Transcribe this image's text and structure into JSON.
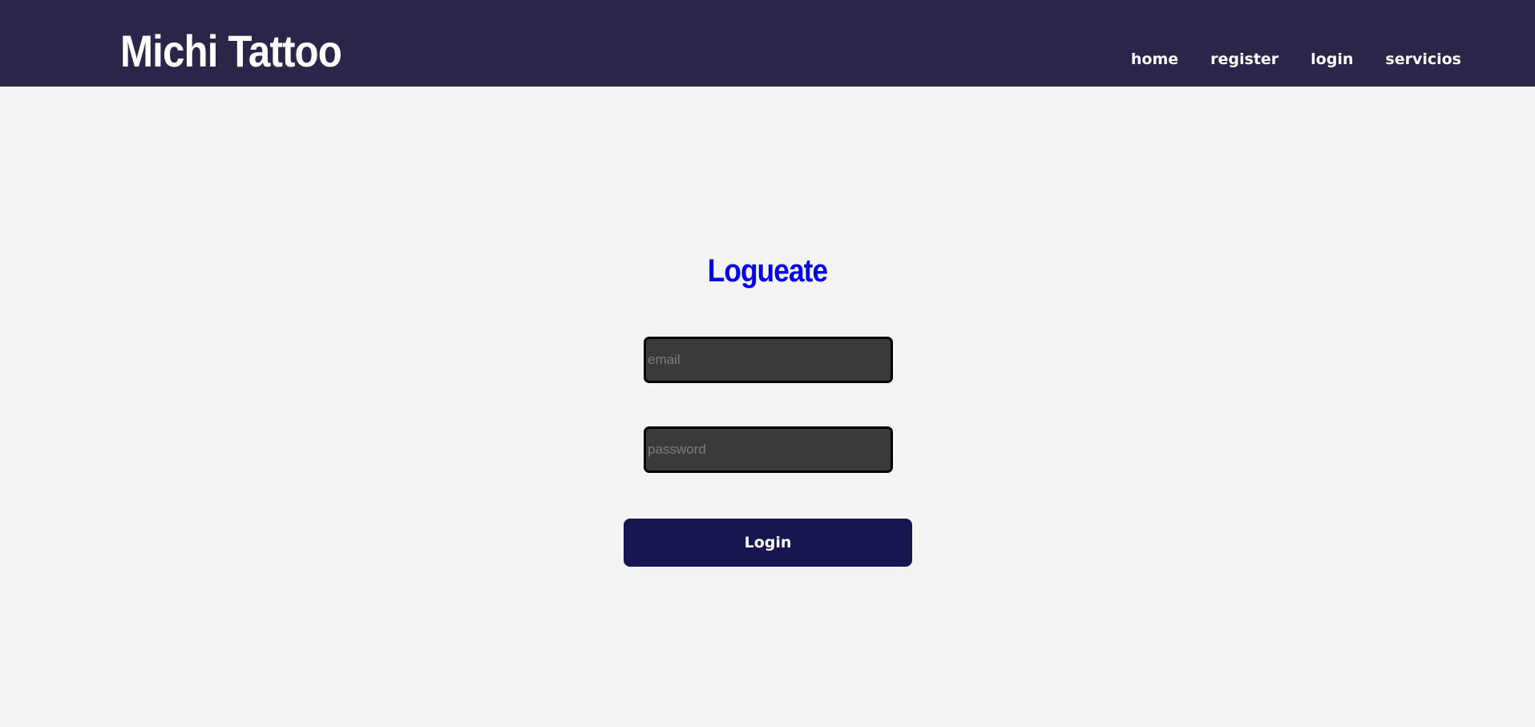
{
  "colors": {
    "navbar_bg": "#2a2549",
    "page_bg": "#f4f4f4",
    "title_color": "#0000ee",
    "button_bg": "#181650",
    "input_bg": "#3a3a3a"
  },
  "header": {
    "brand": "Michi Tattoo",
    "nav": [
      {
        "label": "home"
      },
      {
        "label": "register"
      },
      {
        "label": "login"
      },
      {
        "label": "servicios"
      }
    ]
  },
  "login_form": {
    "title": "Logueate",
    "email_placeholder": "email",
    "password_placeholder": "password",
    "submit_label": "Login"
  }
}
